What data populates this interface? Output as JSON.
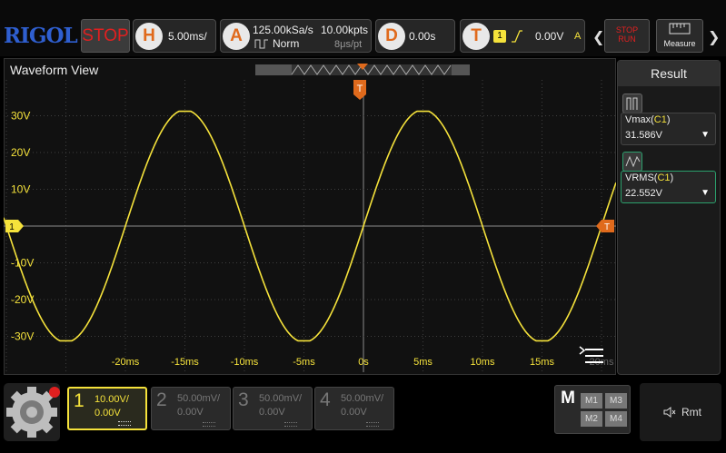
{
  "brand": "RIGOL",
  "run_state": "STOP",
  "horizontal": {
    "badge": "H",
    "scale": "5.00ms/"
  },
  "acquire": {
    "badge": "A",
    "sample_rate": "125.00kSa/s",
    "points": "10.00kpts",
    "mode": "Norm",
    "time_per_pt": "8μs/pt"
  },
  "delay": {
    "badge": "D",
    "value": "0.00s"
  },
  "trigger": {
    "badge": "T",
    "source": "1",
    "level": "0.00V",
    "mode": "A"
  },
  "stop_run": {
    "line1": "STOP",
    "line2": "RUN"
  },
  "measure_label": "Measure",
  "waveform_view": {
    "title": "Waveform View",
    "trigger_marker": "T",
    "channel_marker": "1",
    "y_ticks": [
      "30V",
      "20V",
      "10V",
      "-10V",
      "-20V",
      "-30V"
    ],
    "x_ticks": [
      "-20ms",
      "-15ms",
      "-10ms",
      "-5ms",
      "0s",
      "5ms",
      "10ms",
      "15ms",
      "20ms"
    ]
  },
  "result": {
    "title": "Result",
    "items": [
      {
        "name": "Vmax(",
        "ch": "C1",
        "close": ")",
        "value": "31.586V"
      },
      {
        "name": "VRMS(",
        "ch": "C1",
        "close": ")",
        "value": "22.552V"
      }
    ]
  },
  "channels": [
    {
      "num": "1",
      "scale": "10.00V/",
      "offset": "0.00V",
      "active": true
    },
    {
      "num": "2",
      "scale": "50.00mV/",
      "offset": "0.00V",
      "active": false
    },
    {
      "num": "3",
      "scale": "50.00mV/",
      "offset": "0.00V",
      "active": false
    },
    {
      "num": "4",
      "scale": "50.00mV/",
      "offset": "0.00V",
      "active": false
    }
  ],
  "math": {
    "letter": "M",
    "cells": [
      "M1",
      "M3",
      "M2",
      "M4"
    ]
  },
  "remote": "Rmt",
  "colors": {
    "ch1": "#f5e23b",
    "accent": "#e06a1c",
    "stop": "#e02020",
    "brand": "#2f5fd0"
  }
}
